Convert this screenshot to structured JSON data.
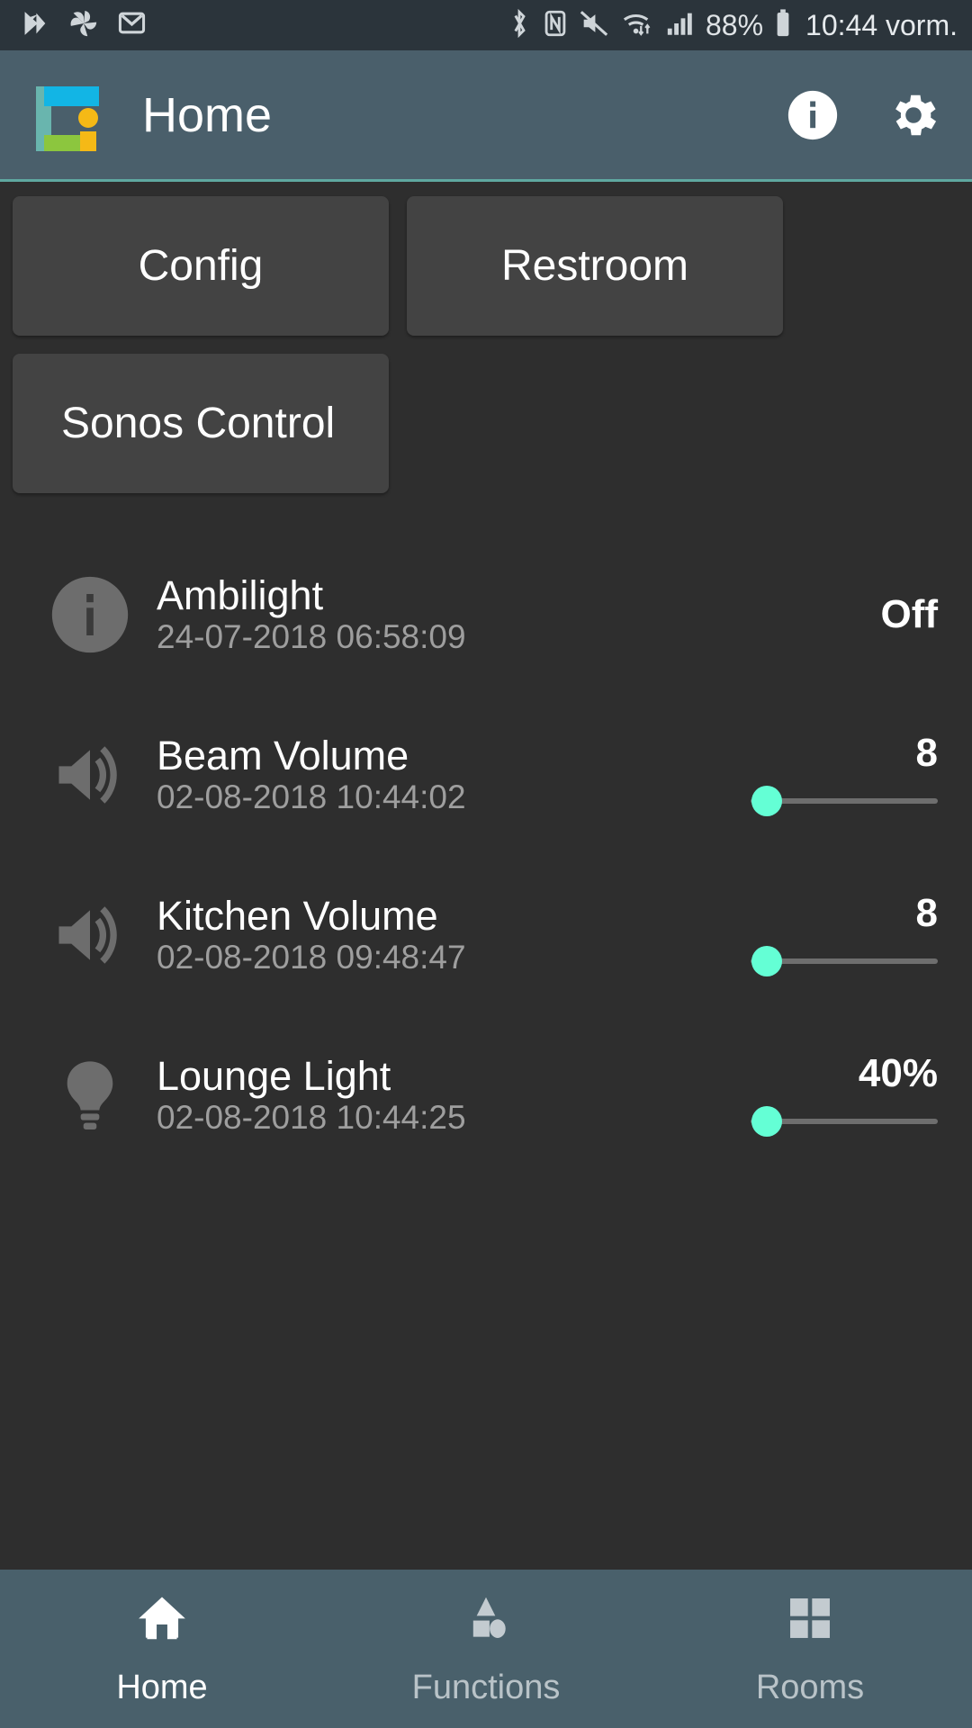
{
  "statusbar": {
    "left_icons": [
      "tasker-check-icon",
      "pinwheel-icon",
      "gmail-icon"
    ],
    "right_icons": [
      "bluetooth-icon",
      "nfc-icon",
      "mute-icon",
      "wifi-data-icon",
      "signal-bars-icon",
      "battery-icon"
    ],
    "battery_percent": "88%",
    "clock": "10:44 vorm."
  },
  "appbar": {
    "title": "Home",
    "logo_name": "openhab-logo",
    "info_icon": "info-icon",
    "settings_icon": "gear-icon",
    "accent_color": "#5fa8a0",
    "background": "#4a5f6b"
  },
  "tiles": [
    {
      "label": "Config",
      "name": "tile-config"
    },
    {
      "label": "Restroom",
      "name": "tile-restroom"
    },
    {
      "label": "Sonos Control",
      "name": "tile-sonos-control"
    }
  ],
  "rows": [
    {
      "name": "row-ambilight",
      "icon": "info-circle-icon",
      "title": "Ambilight",
      "timestamp": "24-07-2018 06:58:09",
      "value": "Off",
      "has_slider": false,
      "slider_percent": 0
    },
    {
      "name": "row-beam-volume",
      "icon": "speaker-volume-icon",
      "title": "Beam Volume",
      "timestamp": "02-08-2018 10:44:02",
      "value": "8",
      "has_slider": true,
      "slider_percent": 8
    },
    {
      "name": "row-kitchen-volume",
      "icon": "speaker-volume-icon",
      "title": "Kitchen Volume",
      "timestamp": "02-08-2018 09:48:47",
      "value": "8",
      "has_slider": true,
      "slider_percent": 8
    },
    {
      "name": "row-lounge-light",
      "icon": "lightbulb-icon",
      "title": "Lounge Light",
      "timestamp": "02-08-2018 10:44:25",
      "value": "40%",
      "has_slider": true,
      "slider_percent": 8
    }
  ],
  "slider_accent": "#64ffd5",
  "bottomnav": {
    "items": [
      {
        "label": "Home",
        "icon": "home-icon",
        "active": true
      },
      {
        "label": "Functions",
        "icon": "shapes-icon",
        "active": false
      },
      {
        "label": "Rooms",
        "icon": "grid-squares-icon",
        "active": false
      }
    ]
  }
}
